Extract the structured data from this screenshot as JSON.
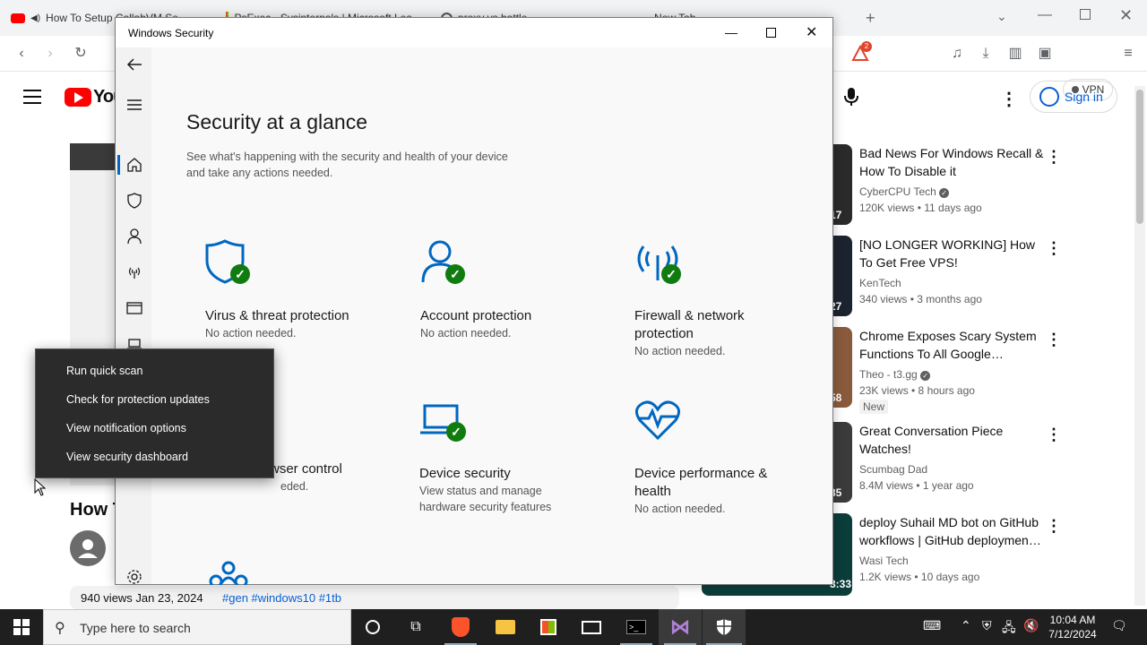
{
  "browser": {
    "tabs": [
      {
        "label": "How To Setup CollabVM Se…"
      },
      {
        "label": "PsExec - Sysinternals | Microsoft Lea…"
      },
      {
        "label": "proxy vs battle"
      },
      {
        "label": "New Tab"
      }
    ],
    "vpn_label": "VPN",
    "notification_count": "2"
  },
  "youtube": {
    "logo_text": "You",
    "signin_label": "Sign in",
    "video_title_partial": "How T",
    "video_meta": "940 views  Jan 23, 2024",
    "video_tags": "#gen #windows10 #1tb",
    "recommendations": [
      {
        "title": "Bad News For Windows Recall & How To Disable it",
        "channel": "CyberCPU Tech",
        "verified": true,
        "meta": "120K views  •  11 days ago",
        "duration": "17",
        "badge": ""
      },
      {
        "title": "[NO LONGER WORKING] How To Get Free VPS!",
        "channel": "KenTech",
        "verified": false,
        "meta": "340 views  •  3 months ago",
        "duration": "27",
        "badge": ""
      },
      {
        "title": "Chrome Exposes Scary System Functions To All Google…",
        "channel": "Theo - t3.gg",
        "verified": true,
        "meta": "23K views  •  8 hours ago",
        "duration": "58",
        "badge": "New"
      },
      {
        "title": "Great Conversation Piece Watches!",
        "channel": "Scumbag Dad",
        "verified": false,
        "meta": "8.4M views  •  1 year ago",
        "duration": "35",
        "badge": ""
      },
      {
        "title": "deploy Suhail MD bot on GitHub workflows | GitHub deploymen…",
        "channel": "Wasi Tech",
        "verified": false,
        "meta": "1.2K views  •  10 days ago",
        "duration": "3:33",
        "badge": ""
      }
    ]
  },
  "security": {
    "window_title": "Windows Security",
    "heading": "Security at a glance",
    "subheading_line1": "See what's happening with the security and health of your device",
    "subheading_line2": "and take any actions needed.",
    "tiles": [
      {
        "title": "Virus & threat protection",
        "title2": "",
        "sub": "No action needed.",
        "sub2": ""
      },
      {
        "title": "Account protection",
        "title2": "",
        "sub": "No action needed.",
        "sub2": ""
      },
      {
        "title": "Firewall & network",
        "title2": "protection",
        "sub": "No action needed.",
        "sub2": ""
      },
      {
        "title": "wser control",
        "title2": "",
        "sub": "eded.",
        "sub2": ""
      },
      {
        "title": "Device security",
        "title2": "",
        "sub": "View status and manage",
        "sub2": "hardware security features"
      },
      {
        "title": "Device performance &",
        "title2": "health",
        "sub": "No action needed.",
        "sub2": ""
      }
    ],
    "accent": "#0067c0",
    "ok_color": "#107c10"
  },
  "context_menu": {
    "items": [
      "Run quick scan",
      "Check for protection updates",
      "View notification options",
      "View security dashboard"
    ]
  },
  "taskbar": {
    "search_placeholder": "Type here to search",
    "time": "10:04 AM",
    "date": "7/12/2024"
  }
}
